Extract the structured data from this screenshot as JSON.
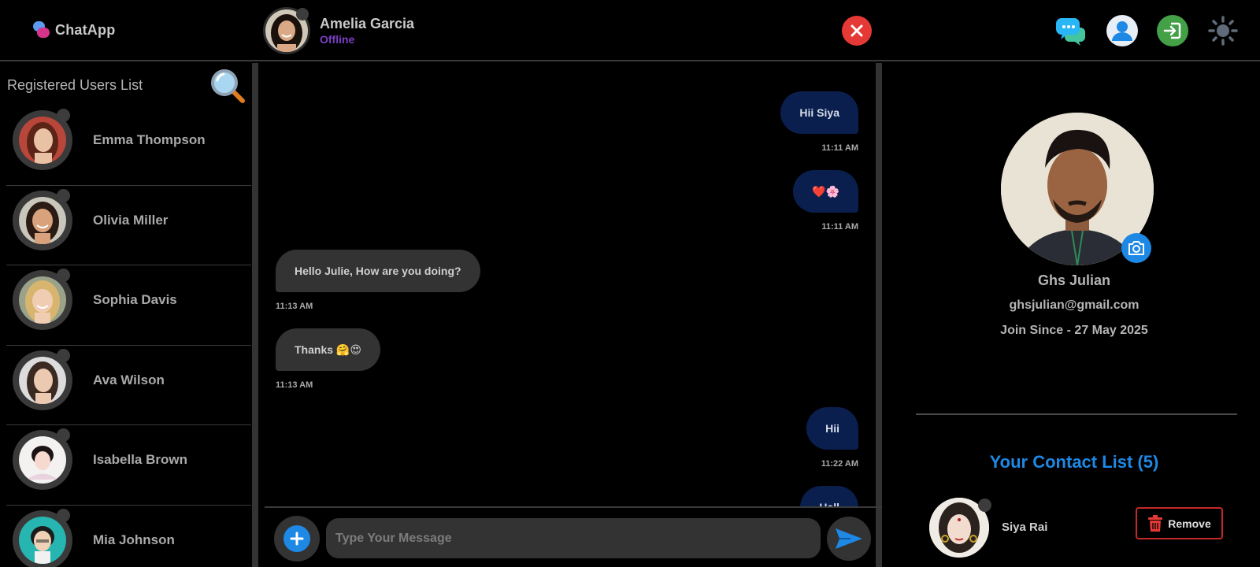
{
  "colors": {
    "accent": "#1e88e5",
    "danger": "#e53935",
    "offline": "#7b3fc4",
    "sent_bubble": "#0a1f4e",
    "recv_bubble": "#333333"
  },
  "header": {
    "brand": "ChatApp",
    "peer": {
      "name": "Amelia Garcia",
      "status": "Offline"
    },
    "icons": [
      "close-icon",
      "chat-bubbles-icon",
      "user-profile-icon",
      "logout-icon",
      "theme-sun-icon"
    ]
  },
  "sidebar": {
    "title": "Registered Users List",
    "users": [
      {
        "name": "Emma Thompson"
      },
      {
        "name": "Olivia Miller"
      },
      {
        "name": "Sophia Davis"
      },
      {
        "name": "Ava Wilson"
      },
      {
        "name": "Isabella Brown"
      },
      {
        "name": "Mia Johnson"
      }
    ]
  },
  "chat": {
    "messages": [
      {
        "dir": "sent",
        "text": "Hii Siya",
        "time": "11:11 AM"
      },
      {
        "dir": "sent",
        "text": "❤️🌸",
        "time": "11:11 AM"
      },
      {
        "dir": "recv",
        "text": "Hello Julie, How are you doing?",
        "time": "11:13 AM"
      },
      {
        "dir": "recv",
        "text": "Thanks 🤗😍",
        "time": "11:13 AM"
      },
      {
        "dir": "sent",
        "text": "Hii",
        "time": "11:22 AM"
      },
      {
        "dir": "sent",
        "text": "Hell",
        "time": ""
      }
    ],
    "input_placeholder": "Type Your Message"
  },
  "profile": {
    "name": "Ghs Julian",
    "email": "ghsjulian@gmail.com",
    "joined": "Join Since - 27 May 2025",
    "contacts_title": "Your Contact List (5)",
    "contacts": [
      {
        "name": "Siya Rai",
        "action": "Remove"
      }
    ]
  }
}
